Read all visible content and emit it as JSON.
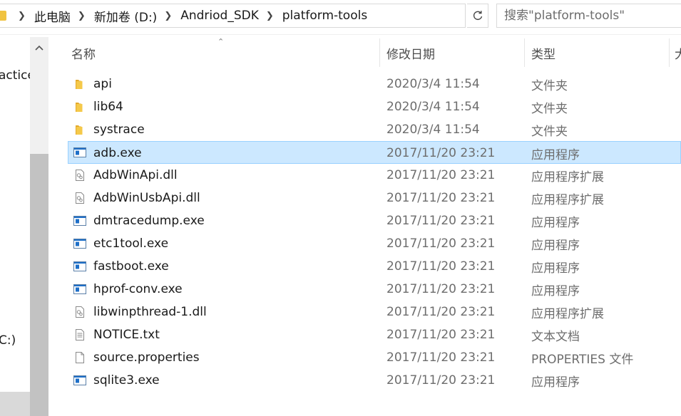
{
  "address_bar": {
    "breadcrumbs": [
      "此电脑",
      "新加卷 (D:)",
      "Andriod_SDK",
      "platform-tools"
    ],
    "search_placeholder": "搜索\"platform-tools\""
  },
  "nav_pane": {
    "partial_items": [
      "actice",
      "C:)"
    ]
  },
  "columns": {
    "name": "名称",
    "date": "修改日期",
    "type": "类型",
    "size": "大"
  },
  "files": [
    {
      "name": "api",
      "date": "2020/3/4 11:54",
      "type": "文件夹",
      "icon": "folder-icon"
    },
    {
      "name": "lib64",
      "date": "2020/3/4 11:54",
      "type": "文件夹",
      "icon": "folder-icon"
    },
    {
      "name": "systrace",
      "date": "2020/3/4 11:54",
      "type": "文件夹",
      "icon": "folder-icon"
    },
    {
      "name": "adb.exe",
      "date": "2017/11/20 23:21",
      "type": "应用程序",
      "icon": "exe-icon",
      "selected": true
    },
    {
      "name": "AdbWinApi.dll",
      "date": "2017/11/20 23:21",
      "type": "应用程序扩展",
      "icon": "dll-icon"
    },
    {
      "name": "AdbWinUsbApi.dll",
      "date": "2017/11/20 23:21",
      "type": "应用程序扩展",
      "icon": "dll-icon"
    },
    {
      "name": "dmtracedump.exe",
      "date": "2017/11/20 23:21",
      "type": "应用程序",
      "icon": "exe-icon"
    },
    {
      "name": "etc1tool.exe",
      "date": "2017/11/20 23:21",
      "type": "应用程序",
      "icon": "exe-icon"
    },
    {
      "name": "fastboot.exe",
      "date": "2017/11/20 23:21",
      "type": "应用程序",
      "icon": "exe-icon"
    },
    {
      "name": "hprof-conv.exe",
      "date": "2017/11/20 23:21",
      "type": "应用程序",
      "icon": "exe-icon"
    },
    {
      "name": "libwinpthread-1.dll",
      "date": "2017/11/20 23:21",
      "type": "应用程序扩展",
      "icon": "dll-icon"
    },
    {
      "name": "NOTICE.txt",
      "date": "2017/11/20 23:21",
      "type": "文本文档",
      "icon": "txt-icon"
    },
    {
      "name": "source.properties",
      "date": "2017/11/20 23:21",
      "type": "PROPERTIES 文件",
      "icon": "blank-file-icon"
    },
    {
      "name": "sqlite3.exe",
      "date": "2017/11/20 23:21",
      "type": "应用程序",
      "icon": "exe-icon"
    }
  ],
  "colors": {
    "selection_bg": "#cce8ff",
    "selection_border": "#99d1ff",
    "folder": "#f0c341",
    "exe_blue": "#1e6fc8"
  }
}
